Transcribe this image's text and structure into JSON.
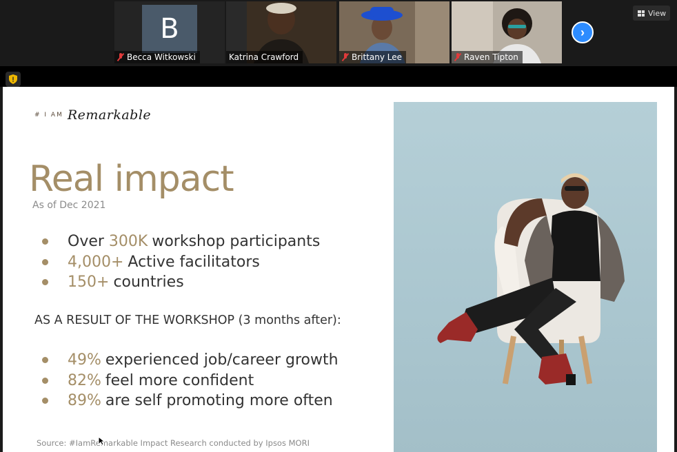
{
  "participants": [
    {
      "name": "Becca Witkowski",
      "avatar_letter": "B",
      "muted": true
    },
    {
      "name": "Katrina Crawford",
      "muted": false
    },
    {
      "name": "Brittany Lee",
      "muted": true
    },
    {
      "name": "Raven Tipton",
      "muted": true
    }
  ],
  "toolbar": {
    "view_label": "View",
    "next_icon": "chevron-right-icon"
  },
  "slide": {
    "logo_hash": "# I AM",
    "logo_script": "Remarkable",
    "title": "Real impact",
    "as_of": "As of Dec 2021",
    "stats": [
      {
        "highlight": "",
        "pre": "Over ",
        "value": "300K",
        "rest": "workshop participants"
      },
      {
        "highlight": "4,000+",
        "rest": "Active facilitators"
      },
      {
        "highlight": "150+",
        "rest": "countries"
      }
    ],
    "result_heading": "AS A RESULT OF THE WORKSHOP (3 months after):",
    "results": [
      {
        "highlight": "49%",
        "rest": "experienced job/career growth"
      },
      {
        "highlight": "82%",
        "rest": "feel more confident"
      },
      {
        "highlight": "89%",
        "rest": "are self promoting more often"
      }
    ],
    "source": "Source: #IamRemarkable Impact Research conducted by Ipsos MORI"
  },
  "colors": {
    "accent": "#a48e67",
    "zoom_blue": "#2d8cff",
    "mute_red": "#e03a3a",
    "active_green": "#9ec05a"
  }
}
